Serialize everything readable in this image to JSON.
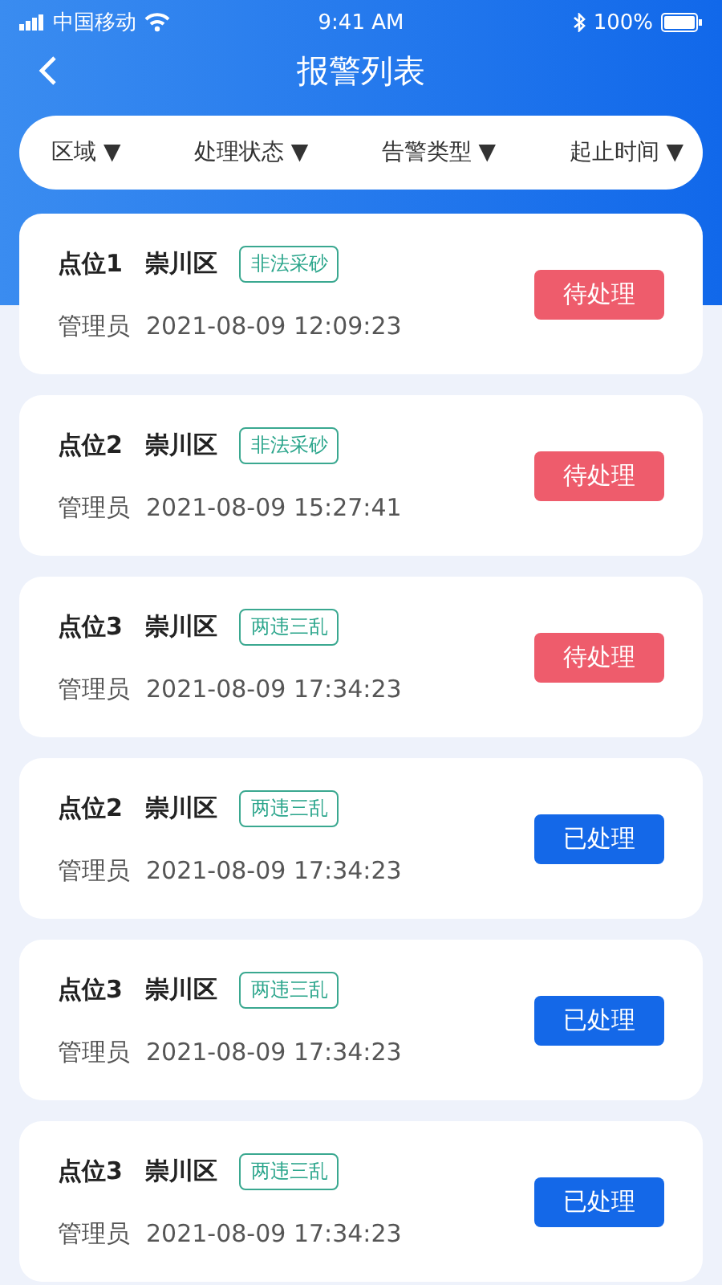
{
  "status_bar": {
    "carrier": "中国移动",
    "time": "9:41 AM",
    "battery": "100%"
  },
  "header": {
    "title": "报警列表"
  },
  "filters": [
    {
      "label": "区域",
      "caret": "▼"
    },
    {
      "label": "处理状态",
      "caret": "▼"
    },
    {
      "label": "告警类型",
      "caret": "▼"
    },
    {
      "label": "起止时间",
      "caret": "▼"
    }
  ],
  "alarms": [
    {
      "point": "点位1",
      "district": "崇川区",
      "tag": "非法采砂",
      "role": "管理员",
      "time": "2021-08-09 12:09:23",
      "kind": "pending",
      "status_label": "待处理"
    },
    {
      "point": "点位2",
      "district": "崇川区",
      "tag": "非法采砂",
      "role": "管理员",
      "time": "2021-08-09 15:27:41",
      "kind": "pending",
      "status_label": "待处理"
    },
    {
      "point": "点位3",
      "district": "崇川区",
      "tag": "两违三乱",
      "role": "管理员",
      "time": "2021-08-09 17:34:23",
      "kind": "pending",
      "status_label": "待处理"
    },
    {
      "point": "点位2",
      "district": "崇川区",
      "tag": "两违三乱",
      "role": "管理员",
      "time": "2021-08-09 17:34:23",
      "kind": "done",
      "status_label": "已处理"
    },
    {
      "point": "点位3",
      "district": "崇川区",
      "tag": "两违三乱",
      "role": "管理员",
      "time": "2021-08-09 17:34:23",
      "kind": "done",
      "status_label": "已处理"
    },
    {
      "point": "点位3",
      "district": "崇川区",
      "tag": "两违三乱",
      "role": "管理员",
      "time": "2021-08-09 17:34:23",
      "kind": "done",
      "status_label": "已处理"
    }
  ]
}
